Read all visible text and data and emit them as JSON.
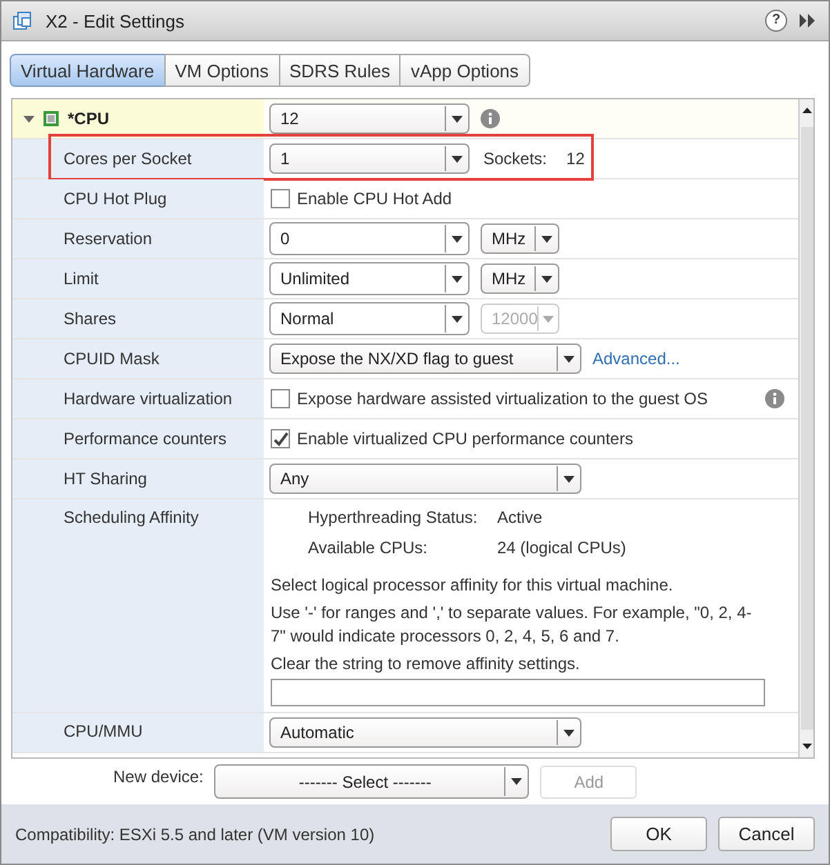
{
  "window": {
    "title": "X2 - Edit Settings",
    "help": "?"
  },
  "tabs": [
    {
      "label": "Virtual Hardware",
      "selected": true
    },
    {
      "label": "VM Options",
      "selected": false
    },
    {
      "label": "SDRS Rules",
      "selected": false
    },
    {
      "label": "vApp Options",
      "selected": false
    }
  ],
  "cpu": {
    "label": "*CPU",
    "expanded": true,
    "value": "12",
    "info": true
  },
  "rows": [
    {
      "kind": "dropdown",
      "label": "Cores per Socket",
      "value": "1",
      "highlighted": true,
      "extra_label": "Sockets:",
      "extra_value": "12"
    },
    {
      "kind": "checkbox",
      "label": "CPU Hot Plug",
      "text": "Enable CPU Hot Add",
      "checked": false
    },
    {
      "kind": "unit",
      "label": "Reservation",
      "value": "0",
      "unit": {
        "value": "MHz",
        "disabled": false
      }
    },
    {
      "kind": "unit",
      "label": "Limit",
      "value": "Unlimited",
      "unit": {
        "value": "MHz",
        "disabled": false
      }
    },
    {
      "kind": "unit",
      "label": "Shares",
      "value": "Normal",
      "unit": {
        "value": "12000",
        "disabled": true
      }
    },
    {
      "kind": "wide",
      "label": "CPUID Mask",
      "value": "Expose the NX/XD flag to guest",
      "link": "Advanced..."
    },
    {
      "kind": "checkbox",
      "label": "Hardware virtualization",
      "text": "Expose hardware assisted virtualization to the guest OS",
      "checked": false,
      "info": true
    },
    {
      "kind": "checkbox",
      "label": "Performance counters",
      "text": "Enable virtualized CPU performance counters",
      "checked": true
    },
    {
      "kind": "wide",
      "label": "HT Sharing",
      "value": "Any"
    },
    {
      "kind": "affinity",
      "label": "Scheduling Affinity",
      "facts": [
        {
          "label": "Hyperthreading Status:",
          "value": "Active"
        },
        {
          "label": "Available CPUs:",
          "value": "24 (logical CPUs)"
        }
      ],
      "paragraphs": [
        "Select logical processor affinity for this virtual machine.",
        "Use '-' for ranges and ',' to separate values. For example,  \"0, 2, 4-7\" would indicate processors 0, 2, 4, 5, 6 and 7.",
        "Clear the string to remove affinity settings."
      ]
    },
    {
      "kind": "wide",
      "label": "CPU/MMU",
      "value": "Automatic"
    }
  ],
  "new_device": {
    "label": "New device:",
    "select": "------- Select -------",
    "add": {
      "label": "Add",
      "disabled": true
    }
  },
  "footer": {
    "compatibility": "Compatibility: ESXi 5.5 and later (VM version 10)",
    "buttons": [
      "OK",
      "Cancel"
    ]
  }
}
